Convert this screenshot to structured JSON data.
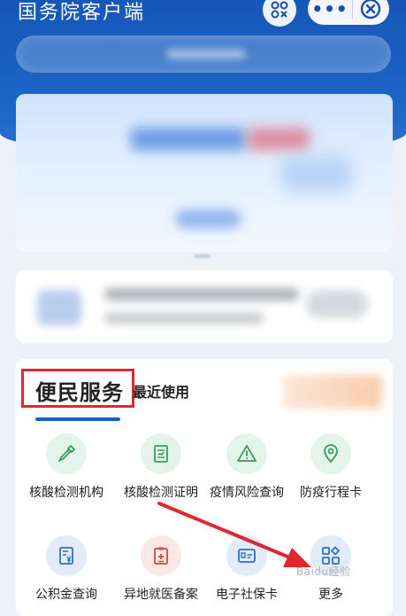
{
  "header": {
    "title": "国务院客户端",
    "more_glyph": "•••"
  },
  "services": {
    "tabs": [
      {
        "label": "便民服务"
      },
      {
        "label": "最近使用"
      }
    ],
    "items": [
      {
        "label": "核酸检测机构",
        "icon": "dropper-icon"
      },
      {
        "label": "核酸检测证明",
        "icon": "certificate-icon"
      },
      {
        "label": "疫情风险查询",
        "icon": "warning-icon"
      },
      {
        "label": "防疫行程卡",
        "icon": "location-pin-icon"
      },
      {
        "label": "公积金查询",
        "icon": "fund-doc-icon"
      },
      {
        "label": "异地就医备案",
        "icon": "medical-record-icon"
      },
      {
        "label": "电子社保卡",
        "icon": "id-card-icon"
      },
      {
        "label": "更多",
        "icon": "grid-more-icon"
      }
    ]
  },
  "watermark": "Baidu经验",
  "colors": {
    "primary": "#1e66c8",
    "annotation_red": "#e0262e",
    "green_icon": "#3a9b5c",
    "blue_icon": "#2f6fc9",
    "red_icon": "#d4473c"
  }
}
